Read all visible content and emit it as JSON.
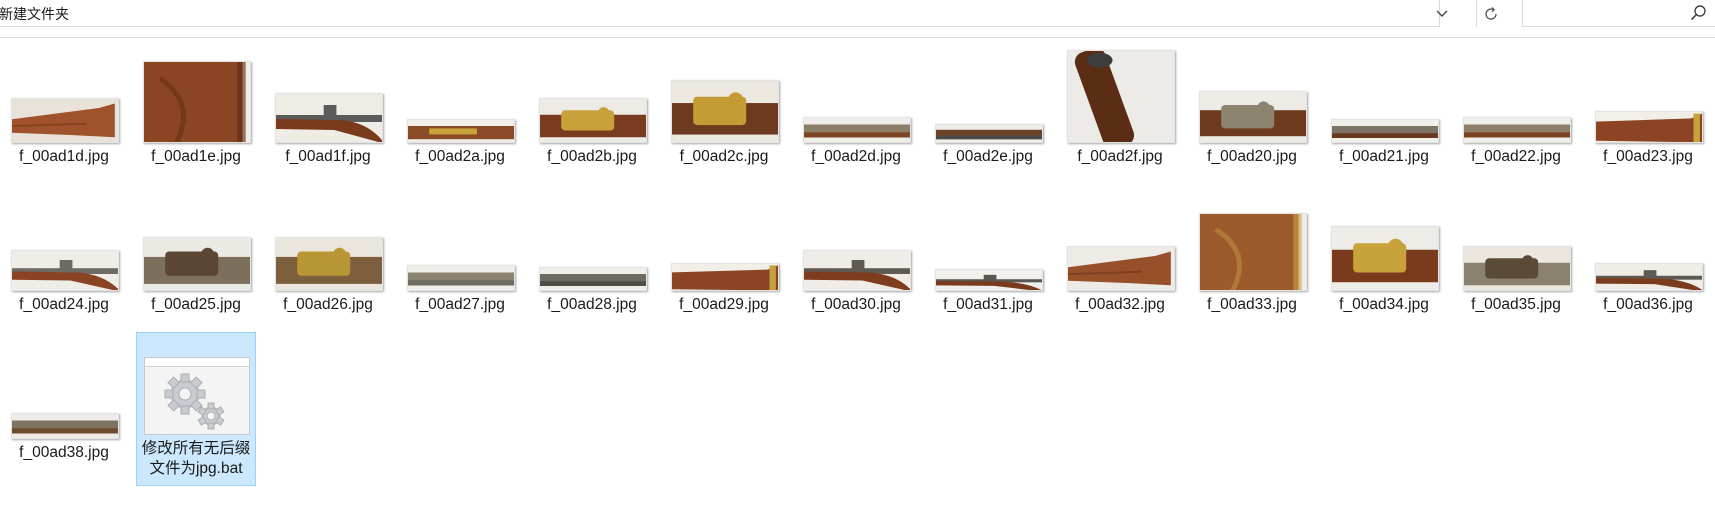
{
  "address_bar": {
    "path": "新建文件夹",
    "dropdown_icon": "chevron-down-icon",
    "refresh_icon": "refresh-icon"
  },
  "search": {
    "placeholder": "",
    "icon": "search-icon"
  },
  "files": [
    {
      "name": "f_00ad1d.jpg",
      "kind": "stock",
      "aspect": 0.42,
      "colors": [
        "#e9e2d8",
        "#a0522d",
        "#6b3414"
      ]
    },
    {
      "name": "f_00ad1e.jpg",
      "kind": "stock-close",
      "aspect": 0.76,
      "colors": [
        "#f1ede7",
        "#8a4523",
        "#5a2a10"
      ]
    },
    {
      "name": "f_00ad1f.jpg",
      "kind": "rifle",
      "aspect": 0.46,
      "colors": [
        "#efece6",
        "#7a3a1c",
        "#5b5b5b"
      ]
    },
    {
      "name": "f_00ad2a.jpg",
      "kind": "barrel-brass",
      "aspect": 0.22,
      "colors": [
        "#f0eee8",
        "#8a4a25",
        "#c8a23a"
      ]
    },
    {
      "name": "f_00ad2b.jpg",
      "kind": "lock-brass",
      "aspect": 0.42,
      "colors": [
        "#eeebe5",
        "#7a3c1e",
        "#c9a13a"
      ]
    },
    {
      "name": "f_00ad2c.jpg",
      "kind": "lock-brass",
      "aspect": 0.58,
      "colors": [
        "#ece8e0",
        "#6e3a1f",
        "#c49b34"
      ]
    },
    {
      "name": "f_00ad2d.jpg",
      "kind": "barrel",
      "aspect": 0.24,
      "colors": [
        "#f0eee9",
        "#7d4423",
        "#8c7f6a"
      ]
    },
    {
      "name": "f_00ad2e.jpg",
      "kind": "barrel",
      "aspect": 0.18,
      "colors": [
        "#f0eee9",
        "#4d4a45",
        "#6b4427"
      ]
    },
    {
      "name": "f_00ad2f.jpg",
      "kind": "muzzle",
      "aspect": 0.86,
      "colors": [
        "#ecebe8",
        "#5a2d14",
        "#3d3d3d"
      ]
    },
    {
      "name": "f_00ad20.jpg",
      "kind": "lock",
      "aspect": 0.48,
      "colors": [
        "#eeebe6",
        "#6e3b1e",
        "#8d8470"
      ]
    },
    {
      "name": "f_00ad21.jpg",
      "kind": "barrel",
      "aspect": 0.22,
      "colors": [
        "#f1efea",
        "#6a3a1f",
        "#7d7666"
      ]
    },
    {
      "name": "f_00ad22.jpg",
      "kind": "barrel",
      "aspect": 0.24,
      "colors": [
        "#f1efea",
        "#7a4422",
        "#8c806a"
      ]
    },
    {
      "name": "f_00ad23.jpg",
      "kind": "stock-brass",
      "aspect": 0.3,
      "colors": [
        "#f2efe9",
        "#8c4424",
        "#c7a33c"
      ]
    },
    {
      "name": "f_00ad24.jpg",
      "kind": "rifle",
      "aspect": 0.38,
      "colors": [
        "#efede8",
        "#8a4323",
        "#6c6a63"
      ]
    },
    {
      "name": "f_00ad25.jpg",
      "kind": "lock",
      "aspect": 0.5,
      "colors": [
        "#ebe9e4",
        "#7c6f5c",
        "#5a4632"
      ]
    },
    {
      "name": "f_00ad26.jpg",
      "kind": "lock-brass",
      "aspect": 0.5,
      "colors": [
        "#eae6de",
        "#7d5f3e",
        "#b99634"
      ]
    },
    {
      "name": "f_00ad27.jpg",
      "kind": "barrel",
      "aspect": 0.24,
      "colors": [
        "#f0eee9",
        "#6f6a5f",
        "#8a8372"
      ]
    },
    {
      "name": "f_00ad28.jpg",
      "kind": "barrel",
      "aspect": 0.22,
      "colors": [
        "#f0eee9",
        "#4f4d49",
        "#706b61"
      ]
    },
    {
      "name": "f_00ad29.jpg",
      "kind": "stock-brass",
      "aspect": 0.26,
      "colors": [
        "#f2efe9",
        "#8b4525",
        "#c6a03a"
      ]
    },
    {
      "name": "f_00ad30.jpg",
      "kind": "rifle",
      "aspect": 0.38,
      "colors": [
        "#f0ede8",
        "#7e3d1e",
        "#5e5a52"
      ]
    },
    {
      "name": "f_00ad31.jpg",
      "kind": "rifle-long",
      "aspect": 0.2,
      "colors": [
        "#f2f0ec",
        "#7a3b1c",
        "#5a5650"
      ]
    },
    {
      "name": "f_00ad32.jpg",
      "kind": "stock",
      "aspect": 0.42,
      "colors": [
        "#eeebe6",
        "#96502a",
        "#6a3315"
      ]
    },
    {
      "name": "f_00ad33.jpg",
      "kind": "stock-close",
      "aspect": 0.72,
      "colors": [
        "#efebe5",
        "#9b5a2c",
        "#c8a144"
      ]
    },
    {
      "name": "f_00ad34.jpg",
      "kind": "lock-brass",
      "aspect": 0.6,
      "colors": [
        "#eeece7",
        "#7a3b1d",
        "#c8a23a"
      ]
    },
    {
      "name": "f_00ad35.jpg",
      "kind": "lock",
      "aspect": 0.42,
      "colors": [
        "#ebe7df",
        "#8a826f",
        "#5b4a35"
      ]
    },
    {
      "name": "f_00ad36.jpg",
      "kind": "rifle-long",
      "aspect": 0.26,
      "colors": [
        "#f0ede8",
        "#7b3c1d",
        "#5e5a52"
      ]
    },
    {
      "name": "f_00ad38.jpg",
      "kind": "barrel",
      "aspect": 0.24,
      "colors": [
        "#efece7",
        "#6e4a2a",
        "#7d7360"
      ]
    },
    {
      "name": "修改所有无后缀文件为jpg.bat",
      "kind": "bat",
      "selected": true,
      "icon": "gears-icon"
    }
  ]
}
